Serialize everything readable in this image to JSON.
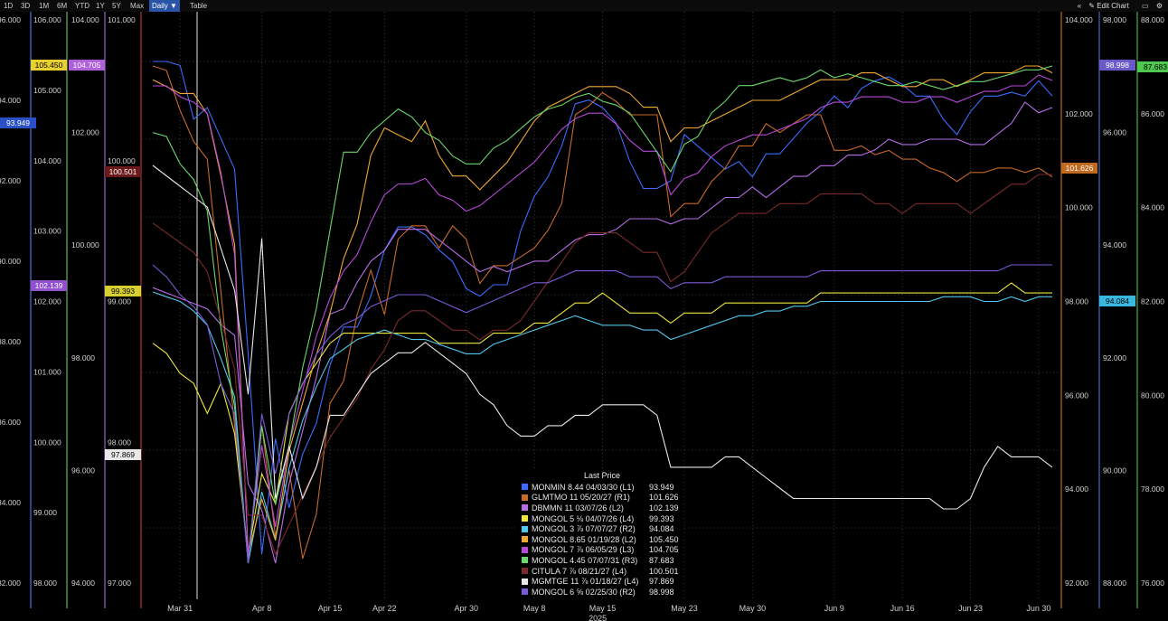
{
  "toolbar": {
    "ranges": [
      "1D",
      "3D",
      "1M",
      "6M",
      "YTD",
      "1Y",
      "5Y",
      "Max"
    ],
    "period": "Daily ▼",
    "table": "Table",
    "edit": "Edit Chart"
  },
  "chart_data": {
    "type": "line",
    "x": [
      "Mar 27",
      "Mar 28",
      "Mar 31",
      "Apr 1",
      "Apr 2",
      "Apr 3",
      "Apr 4",
      "Apr 7",
      "Apr 8",
      "Apr 9",
      "Apr 10",
      "Apr 11",
      "Apr 14",
      "Apr 15",
      "Apr 16",
      "Apr 17",
      "Apr 21",
      "Apr 22",
      "Apr 23",
      "Apr 24",
      "Apr 25",
      "Apr 28",
      "Apr 29",
      "Apr 30",
      "May 2",
      "May 5",
      "May 6",
      "May 7",
      "May 8",
      "May 9",
      "May 12",
      "May 13",
      "May 14",
      "May 15",
      "May 16",
      "May 19",
      "May 20",
      "May 21",
      "May 22",
      "May 23",
      "May 26",
      "May 27",
      "May 28",
      "May 29",
      "May 30",
      "Jun 2",
      "Jun 3",
      "Jun 4",
      "Jun 5",
      "Jun 6",
      "Jun 9",
      "Jun 10",
      "Jun 11",
      "Jun 12",
      "Jun 13",
      "Jun 16",
      "Jun 17",
      "Jun 18",
      "Jun 19",
      "Jun 20",
      "Jun 23",
      "Jun 24",
      "Jun 25",
      "Jun 26",
      "Jun 27",
      "Jun 30",
      "Jul 1"
    ],
    "x_tick_labels": [
      "Mar 31",
      "Apr 8",
      "Apr 15",
      "Apr 22",
      "Apr 30",
      "May 8",
      "May 15",
      "May 23",
      "May 30",
      "Jun 9",
      "Jun 16",
      "Jun 23",
      "Jun 30"
    ],
    "x_year_label": "2025",
    "axes": [
      {
        "id": "A1",
        "side": "left",
        "color": "#5a8cff",
        "ticks": [
          "96.000",
          "94.000",
          "92.000",
          "90.000",
          "88.000",
          "86.000",
          "84.000",
          "82.000"
        ]
      },
      {
        "id": "A2",
        "side": "left",
        "color": "#78d878",
        "ticks": [
          "106.000",
          "105.000",
          "104.000",
          "103.000",
          "102.000",
          "101.000",
          "100.000",
          "99.000",
          "98.000"
        ]
      },
      {
        "id": "A3",
        "side": "left",
        "color": "#c070ff",
        "ticks": [
          "104.000",
          "102.000",
          "100.000",
          "98.000",
          "96.000",
          "94.000"
        ]
      },
      {
        "id": "A4",
        "side": "left",
        "color": "#d04040",
        "ticks": [
          "101.000",
          "100.000",
          "99.000",
          "98.000",
          "97.000"
        ]
      },
      {
        "id": "B1",
        "side": "right",
        "color": "#e08030",
        "ticks": [
          "104.000",
          "102.000",
          "100.000",
          "98.000",
          "96.000",
          "94.000",
          "92.000"
        ]
      },
      {
        "id": "B2",
        "side": "right",
        "color": "#5080e0",
        "ticks": [
          "98.000",
          "96.000",
          "94.000",
          "92.000",
          "90.000",
          "88.000"
        ]
      },
      {
        "id": "B3",
        "side": "right",
        "color": "#50d050",
        "ticks": [
          "88.000",
          "86.000",
          "84.000",
          "82.000",
          "80.000",
          "78.000",
          "76.000"
        ]
      }
    ],
    "series": [
      {
        "name": "MONMIN 8.44 04/03/30  (L1)",
        "last": "93.949",
        "color": "#3b6cff",
        "values": [
          95.6,
          95.6,
          95.5,
          94.1,
          94.4,
          93.6,
          92.8,
          88.0,
          82.8,
          85.8,
          84.0,
          85.4,
          86.2,
          87.7,
          88.7,
          88.7,
          89.5,
          90.7,
          91.3,
          91.3,
          91.1,
          90.7,
          90.4,
          89.7,
          89.5,
          89.8,
          89.8,
          91.2,
          92.1,
          92.6,
          93.4,
          94.5,
          94.6,
          94.4,
          94.0,
          93.0,
          92.3,
          92.3,
          92.5,
          93.7,
          93.4,
          93.1,
          92.8,
          93.0,
          92.6,
          93.2,
          93.2,
          93.6,
          94.0,
          94.3,
          94.7,
          94.4,
          94.9,
          95.1,
          95.2,
          95.0,
          94.7,
          94.7,
          94.1,
          93.7,
          94.3,
          94.7,
          94.7,
          94.8,
          94.7,
          95.1,
          94.7
        ]
      },
      {
        "name": "GLMTMO 11 05/20/27  (R1)",
        "last": "101.626",
        "color": "#c86a28",
        "values": [
          104.1,
          104.0,
          103.1,
          102.4,
          102.0,
          99.0,
          96.0,
          93.0,
          96.0,
          93.5,
          95.0,
          93.0,
          94.0,
          96.5,
          97.0,
          98.5,
          99.5,
          98.5,
          100.2,
          100.5,
          100.5,
          100.0,
          100.5,
          100.2,
          99.2,
          99.6,
          99.6,
          99.8,
          100.0,
          100.4,
          101.0,
          103.0,
          103.2,
          103.5,
          103.3,
          103.0,
          103.0,
          103.0,
          100.7,
          101.0,
          101.0,
          101.5,
          101.8,
          102.3,
          102.3,
          102.8,
          102.6,
          102.8,
          103.0,
          103.0,
          102.2,
          102.2,
          102.3,
          102.1,
          102.2,
          102.0,
          102.0,
          101.8,
          101.7,
          101.5,
          101.7,
          101.7,
          101.8,
          101.8,
          101.7,
          101.8,
          101.6
        ]
      },
      {
        "name": "DBMMN 11 03/07/26  (L2)",
        "last": "102.139",
        "color": "#b86de8",
        "values": [
          98.7,
          98.6,
          98.5,
          98.4,
          98.3,
          98.0,
          97.8,
          95.0,
          94.5,
          93.5,
          95.0,
          96.0,
          97.0,
          98.2,
          98.3,
          98.8,
          99.2,
          99.4,
          99.8,
          99.8,
          99.8,
          99.6,
          99.4,
          99.2,
          99.0,
          99.1,
          99.0,
          99.1,
          99.2,
          99.2,
          99.4,
          99.6,
          99.7,
          99.7,
          99.8,
          100.0,
          100.0,
          100.0,
          99.9,
          100.0,
          100.0,
          100.2,
          100.4,
          100.4,
          100.6,
          100.4,
          100.6,
          100.8,
          100.8,
          101.0,
          101.0,
          101.2,
          101.2,
          101.3,
          101.5,
          101.4,
          101.4,
          101.5,
          101.5,
          101.5,
          101.4,
          101.4,
          101.6,
          101.8,
          102.2,
          102.0,
          102.1
        ]
      },
      {
        "name": "MONGOL 5 ⅛ 04/07/26  (L4)",
        "last": "99.393",
        "color": "#ece83a",
        "values": [
          98.9,
          98.8,
          98.6,
          98.5,
          98.2,
          98.5,
          98.0,
          96.8,
          97.6,
          97.3,
          98.2,
          98.5,
          98.7,
          98.9,
          99.0,
          99.0,
          99.0,
          99.0,
          99.0,
          99.0,
          99.0,
          98.9,
          98.9,
          98.9,
          98.9,
          99.0,
          99.0,
          99.0,
          99.1,
          99.1,
          99.2,
          99.3,
          99.3,
          99.4,
          99.3,
          99.2,
          99.2,
          99.2,
          99.1,
          99.2,
          99.2,
          99.2,
          99.3,
          99.3,
          99.3,
          99.3,
          99.3,
          99.3,
          99.3,
          99.4,
          99.4,
          99.4,
          99.4,
          99.4,
          99.4,
          99.4,
          99.4,
          99.4,
          99.4,
          99.4,
          99.4,
          99.4,
          99.4,
          99.5,
          99.4,
          99.4,
          99.4
        ]
      },
      {
        "name": "MONGOL 3 ⅞ 07/07/27  (R2)",
        "last": "94.084",
        "color": "#4fc8ee",
        "values": [
          94.2,
          94.1,
          94.0,
          93.8,
          93.5,
          92.8,
          92.0,
          88.5,
          90.0,
          89.0,
          90.5,
          91.5,
          92.2,
          92.8,
          93.0,
          93.2,
          93.3,
          93.4,
          93.3,
          93.2,
          93.2,
          93.1,
          93.0,
          92.9,
          92.9,
          93.1,
          93.2,
          93.3,
          93.4,
          93.5,
          93.6,
          93.7,
          93.6,
          93.5,
          93.5,
          93.5,
          93.4,
          93.4,
          93.2,
          93.3,
          93.4,
          93.5,
          93.6,
          93.7,
          93.7,
          93.8,
          93.8,
          93.9,
          93.9,
          94.0,
          94.0,
          94.0,
          94.0,
          94.0,
          94.0,
          94.0,
          94.0,
          94.0,
          94.1,
          94.1,
          94.1,
          94.0,
          94.0,
          94.1,
          94.0,
          94.1,
          94.1
        ]
      },
      {
        "name": "MONGOL 8.65 01/19/28  (L2)",
        "last": "105.450",
        "color": "#f0a830",
        "values": [
          105.4,
          105.3,
          105.2,
          105.2,
          104.9,
          104.0,
          103.0,
          98.5,
          99.3,
          98.7,
          100.0,
          100.7,
          101.4,
          102.0,
          102.8,
          103.3,
          104.3,
          104.7,
          104.6,
          104.5,
          104.8,
          104.3,
          104.0,
          104.0,
          103.8,
          104.0,
          104.2,
          104.5,
          104.8,
          105.0,
          105.1,
          105.2,
          105.3,
          105.3,
          105.3,
          105.2,
          105.0,
          105.0,
          104.5,
          104.7,
          104.7,
          104.8,
          104.9,
          105.0,
          105.1,
          105.1,
          105.1,
          105.2,
          105.3,
          105.4,
          105.4,
          105.4,
          105.5,
          105.5,
          105.4,
          105.3,
          105.3,
          105.4,
          105.4,
          105.3,
          105.4,
          105.5,
          105.5,
          105.5,
          105.6,
          105.6,
          105.5
        ]
      },
      {
        "name": "MONGOL 7 ⅞ 06/05/29  (L3)",
        "last": "104.705",
        "color": "#b848d8",
        "values": [
          104.6,
          104.6,
          104.4,
          104.3,
          104.1,
          103.0,
          101.5,
          96.0,
          98.0,
          96.5,
          98.0,
          99.0,
          100.0,
          100.7,
          101.2,
          101.5,
          102.1,
          102.6,
          102.8,
          102.8,
          102.9,
          102.6,
          102.5,
          102.3,
          102.4,
          102.6,
          102.8,
          103.0,
          103.2,
          103.5,
          103.8,
          104.0,
          104.1,
          104.1,
          103.9,
          103.6,
          103.4,
          103.4,
          102.6,
          102.9,
          103.0,
          103.3,
          103.5,
          103.6,
          103.7,
          103.7,
          103.8,
          103.9,
          104.0,
          104.2,
          104.3,
          104.3,
          104.4,
          104.4,
          104.4,
          104.3,
          104.3,
          104.4,
          104.4,
          104.3,
          104.4,
          104.5,
          104.5,
          104.6,
          104.6,
          104.8,
          104.7
        ]
      },
      {
        "name": "MONGOL 4.45 07/07/31  (R3)",
        "last": "87.683",
        "color": "#6ad86a",
        "values": [
          86.0,
          85.9,
          85.2,
          84.8,
          84.0,
          81.0,
          79.0,
          75.0,
          78.5,
          76.5,
          78.0,
          80.0,
          81.5,
          83.5,
          85.5,
          85.5,
          86.0,
          86.3,
          86.6,
          86.4,
          86.0,
          85.8,
          85.4,
          85.2,
          85.2,
          85.6,
          85.8,
          86.1,
          86.4,
          86.6,
          86.7,
          86.9,
          87.0,
          86.8,
          86.7,
          86.5,
          86.0,
          85.5,
          85.0,
          85.7,
          85.9,
          86.5,
          86.8,
          87.2,
          87.2,
          87.3,
          87.4,
          87.3,
          87.4,
          87.6,
          87.4,
          87.5,
          87.4,
          87.3,
          87.2,
          87.2,
          87.3,
          87.2,
          87.1,
          87.2,
          87.3,
          87.3,
          87.4,
          87.5,
          87.6,
          87.6,
          87.7
        ]
      },
      {
        "name": "CITULA 7 ⅞ 08/21/27  (L4)",
        "last": "100.501",
        "color": "#7a2a2a",
        "values": [
          100.0,
          99.9,
          99.8,
          99.7,
          99.5,
          99.0,
          98.5,
          97.0,
          97.0,
          96.6,
          96.9,
          97.2,
          97.5,
          97.8,
          98.0,
          98.2,
          98.5,
          98.7,
          99.0,
          99.1,
          99.1,
          99.0,
          98.9,
          98.9,
          98.8,
          98.9,
          98.9,
          99.0,
          99.2,
          99.4,
          99.6,
          99.8,
          99.9,
          99.9,
          99.9,
          99.8,
          99.7,
          99.7,
          99.4,
          99.5,
          99.7,
          99.9,
          100.0,
          100.1,
          100.1,
          100.1,
          100.2,
          100.2,
          100.2,
          100.3,
          100.3,
          100.3,
          100.3,
          100.2,
          100.2,
          100.1,
          100.2,
          100.2,
          100.2,
          100.2,
          100.1,
          100.2,
          100.3,
          100.4,
          100.4,
          100.5,
          100.5
        ]
      },
      {
        "name": "MGMTGE 11 ⅞ 01/18/27  (L4)",
        "last": "97.869",
        "color": "#e8e8e8",
        "values": [
          100.2,
          100.1,
          100.0,
          99.9,
          99.8,
          99.4,
          99.0,
          98.0,
          99.5,
          97.0,
          97.5,
          97.0,
          97.3,
          97.8,
          97.8,
          98.0,
          98.2,
          98.3,
          98.4,
          98.4,
          98.5,
          98.4,
          98.3,
          98.2,
          98.0,
          97.9,
          97.7,
          97.6,
          97.6,
          97.7,
          97.7,
          97.8,
          97.8,
          97.9,
          97.9,
          97.9,
          97.9,
          97.8,
          97.3,
          97.3,
          97.3,
          97.3,
          97.4,
          97.4,
          97.3,
          97.2,
          97.1,
          97.0,
          97.0,
          97.0,
          97.0,
          97.0,
          97.0,
          97.0,
          97.0,
          97.0,
          97.0,
          97.0,
          96.9,
          96.9,
          97.0,
          97.3,
          97.5,
          97.4,
          97.4,
          97.4,
          97.3
        ]
      },
      {
        "name": "MONGOL 6 ⅝ 02/25/30  (R2)",
        "last": "98.998",
        "color": "#7a5ad8",
        "values": [
          99.0,
          98.8,
          98.5,
          98.3,
          98.0,
          97.0,
          96.5,
          94.0,
          96.5,
          95.5,
          96.5,
          97.0,
          97.5,
          97.8,
          98.0,
          98.1,
          98.3,
          98.4,
          98.5,
          98.5,
          98.5,
          98.4,
          98.3,
          98.2,
          98.3,
          98.4,
          98.5,
          98.6,
          98.7,
          98.7,
          98.8,
          98.9,
          98.9,
          98.9,
          98.9,
          98.8,
          98.8,
          98.8,
          98.6,
          98.7,
          98.7,
          98.7,
          98.8,
          98.8,
          98.8,
          98.8,
          98.8,
          98.8,
          98.8,
          98.9,
          98.9,
          98.9,
          98.9,
          98.9,
          98.9,
          98.9,
          98.9,
          98.9,
          98.9,
          98.9,
          98.9,
          98.9,
          98.9,
          99.0,
          99.0,
          99.0,
          99.0
        ]
      }
    ],
    "legend_title": "Last Price",
    "value_tags": [
      {
        "text": "105.450",
        "color": "#e8d030"
      },
      {
        "text": "104.705",
        "color": "#b060d8"
      },
      {
        "text": "93.949",
        "color": "#2a50c8"
      },
      {
        "text": "100.501",
        "color": "#6a1a1a"
      },
      {
        "text": "102.139",
        "color": "#9050d0"
      },
      {
        "text": "99.393",
        "color": "#d8d030"
      },
      {
        "text": "97.869",
        "color": "#e8e8e8"
      },
      {
        "text": "98.998",
        "color": "#6a5ac8"
      },
      {
        "text": "87.683",
        "color": "#50c850"
      },
      {
        "text": "101.626",
        "color": "#c06a20"
      },
      {
        "text": "94.084",
        "color": "#38b8e0"
      }
    ]
  }
}
